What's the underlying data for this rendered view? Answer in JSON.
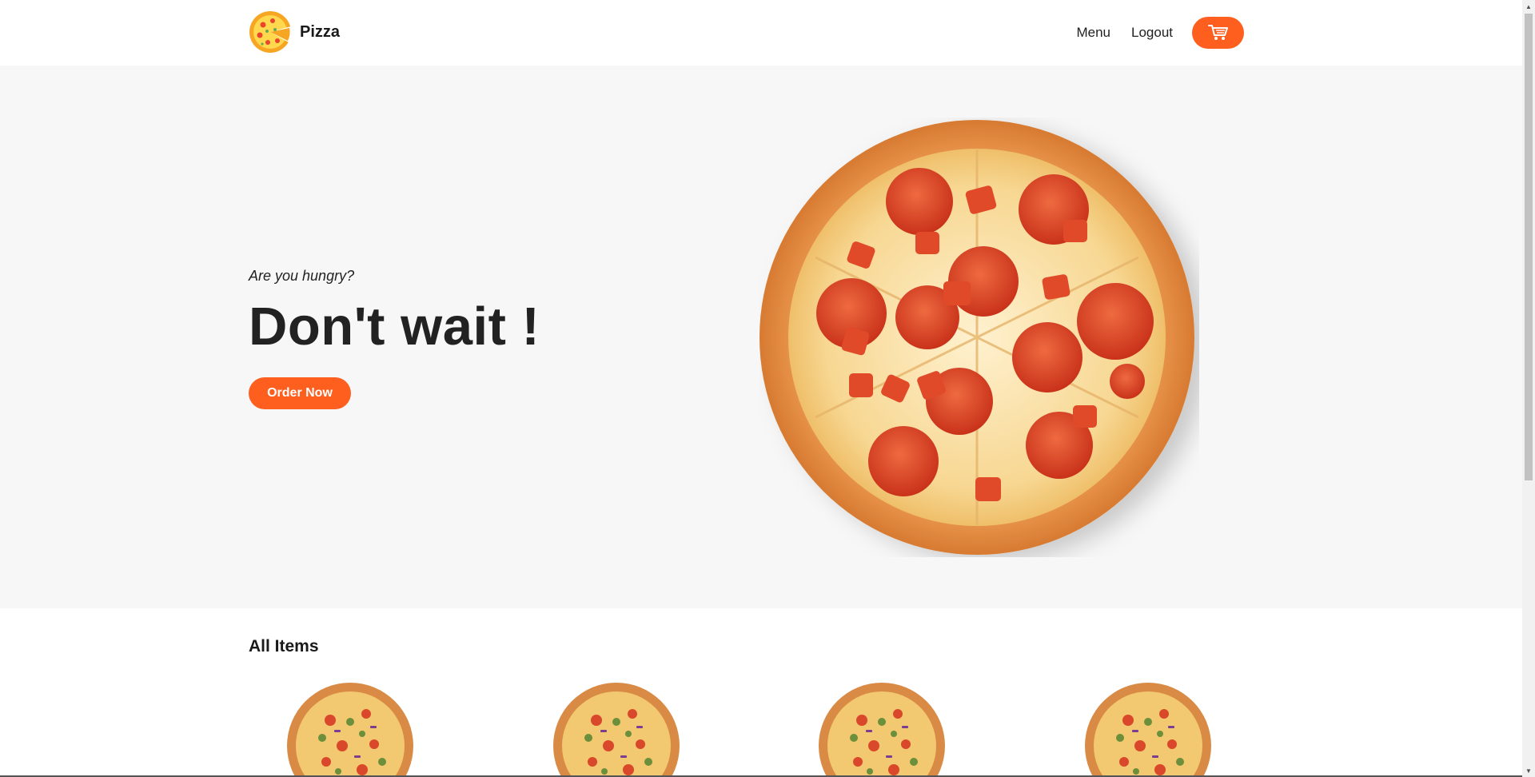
{
  "navbar": {
    "brand_name": "Pizza",
    "links": [
      "Menu",
      "Logout"
    ],
    "cart_icon": "cart-icon"
  },
  "hero": {
    "subtitle": "Are you hungry?",
    "title": "Don't wait !",
    "cta_label": "Order Now"
  },
  "items": {
    "heading": "All Items",
    "count_visible": 4
  },
  "colors": {
    "accent": "#fe5f1e",
    "hero_bg": "#f7f7f7",
    "text": "#222222"
  }
}
